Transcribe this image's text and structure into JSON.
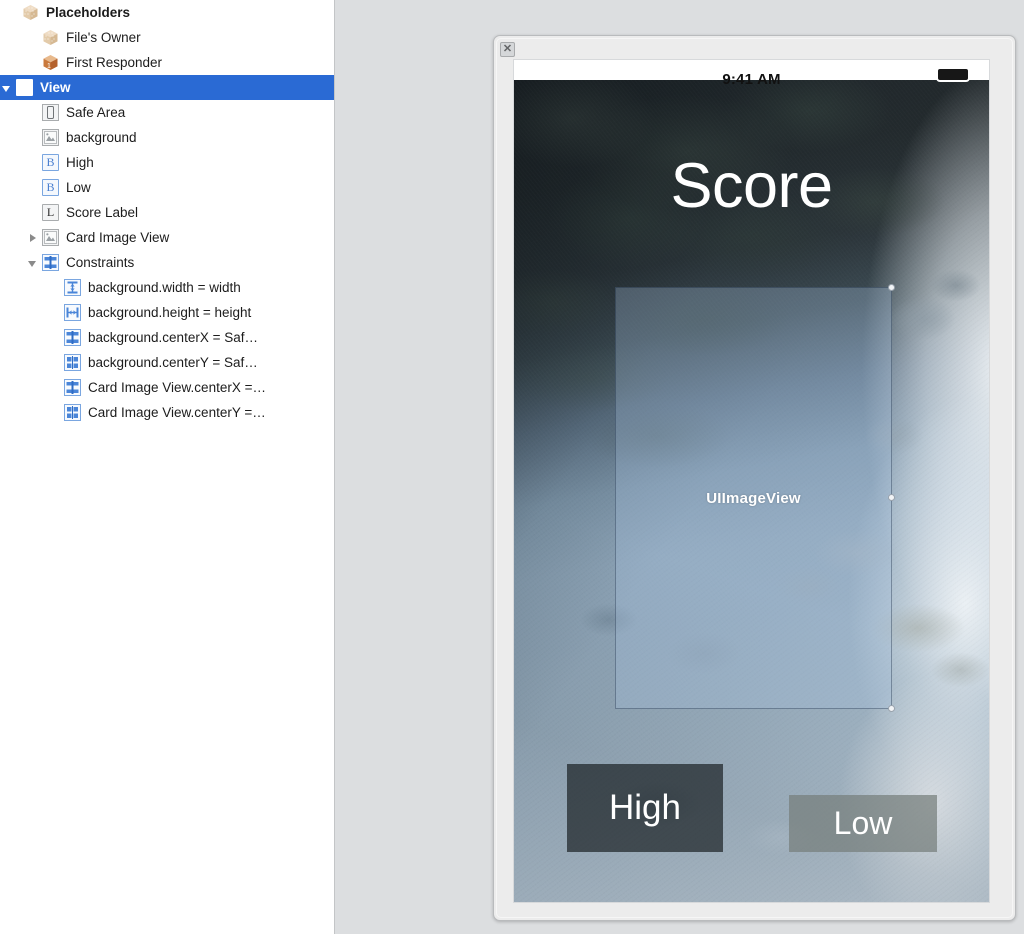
{
  "outline": {
    "rows": [
      {
        "label": "Placeholders",
        "icon": "cube-icon",
        "indent": 24,
        "twisty": "none",
        "bold": true,
        "selected": false
      },
      {
        "label": "File's Owner",
        "icon": "cube-light-icon",
        "indent": 44,
        "twisty": "none",
        "bold": false,
        "selected": false
      },
      {
        "label": "First Responder",
        "icon": "cube-responder-icon",
        "indent": 44,
        "twisty": "none",
        "bold": false,
        "selected": false
      },
      {
        "label": "View",
        "icon": "view-square-icon",
        "indent": 4,
        "twisty": "down",
        "bold": true,
        "selected": true
      },
      {
        "label": "Safe Area",
        "icon": "safe-area-icon",
        "indent": 44,
        "twisty": "none",
        "bold": false,
        "selected": false
      },
      {
        "label": "background",
        "icon": "image-view-icon",
        "indent": 44,
        "twisty": "none",
        "bold": false,
        "selected": false
      },
      {
        "label": "High",
        "icon": "button-b-icon",
        "indent": 44,
        "twisty": "none",
        "bold": false,
        "selected": false
      },
      {
        "label": "Low",
        "icon": "button-b-icon",
        "indent": 44,
        "twisty": "none",
        "bold": false,
        "selected": false
      },
      {
        "label": "Score Label",
        "icon": "label-l-icon",
        "indent": 44,
        "twisty": "none",
        "bold": false,
        "selected": false
      },
      {
        "label": "Card Image View",
        "icon": "image-view-icon",
        "indent": 44,
        "twisty": "right",
        "bold": false,
        "selected": false
      },
      {
        "label": "Constraints",
        "icon": "constraints-icon",
        "indent": 44,
        "twisty": "down",
        "bold": false,
        "selected": false
      },
      {
        "label": "background.width = width",
        "icon": "constraint-width-icon",
        "indent": 66,
        "twisty": "none",
        "bold": false,
        "selected": false
      },
      {
        "label": "background.height = height",
        "icon": "constraint-height-icon",
        "indent": 66,
        "twisty": "none",
        "bold": false,
        "selected": false
      },
      {
        "label": "background.centerX = Saf…",
        "icon": "constraint-centerx-icon",
        "indent": 66,
        "twisty": "none",
        "bold": false,
        "selected": false
      },
      {
        "label": "background.centerY = Saf…",
        "icon": "constraint-centery-icon",
        "indent": 66,
        "twisty": "none",
        "bold": false,
        "selected": false
      },
      {
        "label": "Card Image View.centerX =…",
        "icon": "constraint-centerx-icon",
        "indent": 66,
        "twisty": "none",
        "bold": false,
        "selected": false
      },
      {
        "label": "Card Image View.centerY =…",
        "icon": "constraint-centery-icon",
        "indent": 66,
        "twisty": "none",
        "bold": false,
        "selected": false
      }
    ],
    "selection_color": "#2a6ad4"
  },
  "canvas": {
    "background_color": "#dcdee0",
    "close_button_glyph": "✕",
    "device": {
      "status_bar": {
        "time": "9:41 AM",
        "battery_icon": "battery-icon"
      },
      "score_label": "Score",
      "card_image_view_label": "UIImageView",
      "buttons": [
        {
          "name": "high",
          "label": "High"
        },
        {
          "name": "low",
          "label": "Low"
        }
      ]
    }
  }
}
